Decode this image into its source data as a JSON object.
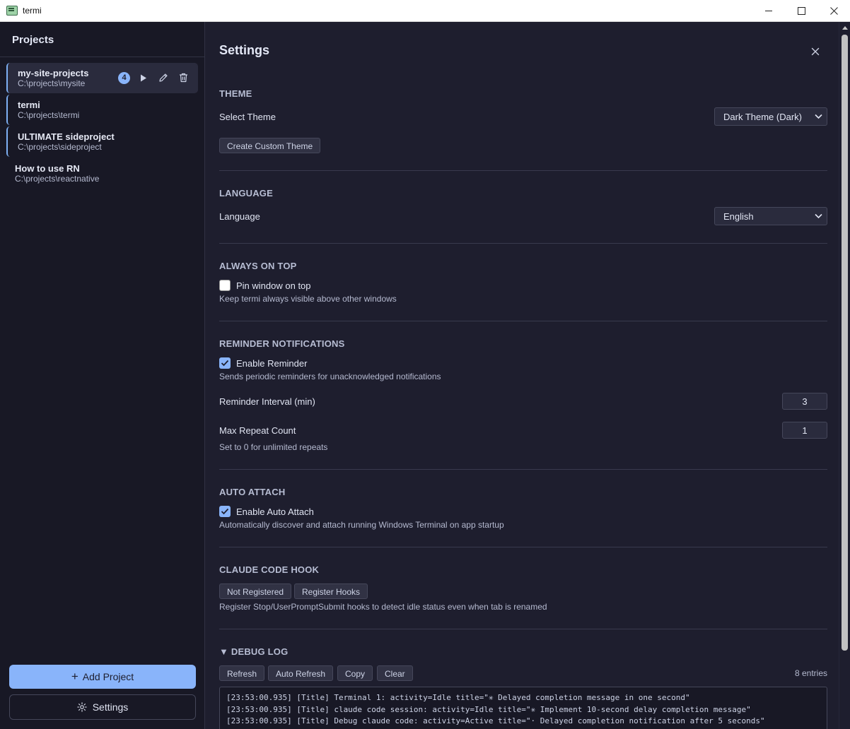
{
  "window": {
    "title": "termi"
  },
  "sidebar": {
    "header": "Projects",
    "projects": [
      {
        "name": "my-site-projects",
        "path": "C:\\projects\\mysite",
        "badge": "4"
      },
      {
        "name": "termi",
        "path": "C:\\projects\\termi"
      },
      {
        "name": "ULTIMATE sideproject",
        "path": "C:\\projects\\sideproject"
      },
      {
        "name": "How to use RN",
        "path": "C:\\projects\\reactnative"
      }
    ],
    "add_project_label": "Add Project",
    "settings_label": "Settings"
  },
  "settings": {
    "title": "Settings",
    "theme": {
      "section": "THEME",
      "select_label": "Select Theme",
      "selected": "Dark Theme (Dark)",
      "custom_button": "Create Custom Theme"
    },
    "language": {
      "section": "LANGUAGE",
      "label": "Language",
      "selected": "English"
    },
    "always_on_top": {
      "section": "ALWAYS ON TOP",
      "checkbox_label": "Pin window on top",
      "checked": false,
      "description": "Keep termi always visible above other windows"
    },
    "reminder": {
      "section": "REMINDER NOTIFICATIONS",
      "checkbox_label": "Enable Reminder",
      "checked": true,
      "description": "Sends periodic reminders for unacknowledged notifications",
      "interval_label": "Reminder Interval (min)",
      "interval_value": "3",
      "max_repeat_label": "Max Repeat Count",
      "max_repeat_value": "1",
      "max_repeat_hint": "Set to 0 for unlimited repeats"
    },
    "auto_attach": {
      "section": "AUTO ATTACH",
      "checkbox_label": "Enable Auto Attach",
      "checked": true,
      "description": "Automatically discover and attach running Windows Terminal on app startup"
    },
    "claude_hook": {
      "section": "CLAUDE CODE HOOK",
      "status_button": "Not Registered",
      "register_button": "Register Hooks",
      "description": "Register Stop/UserPromptSubmit hooks to detect idle status even when tab is renamed"
    },
    "debug_log": {
      "section": "▼ DEBUG LOG",
      "buttons": {
        "refresh": "Refresh",
        "auto_refresh": "Auto Refresh",
        "copy": "Copy",
        "clear": "Clear"
      },
      "entries_count": "8 entries",
      "lines": [
        "[23:53:00.935] [Title] Terminal 1: activity=Idle title=\"✳ Delayed completion message in one second\"",
        "[23:53:00.935] [Title] claude code session: activity=Idle title=\"✳ Implement 10-second delay completion message\"",
        "[23:53:00.935] [Title] Debug claude code: activity=Active title=\"· Delayed completion notification after 5 seconds\""
      ]
    }
  },
  "colors": {
    "accent": "#89b4fa",
    "background": "#1e1e2e",
    "sidebar": "#181825"
  }
}
